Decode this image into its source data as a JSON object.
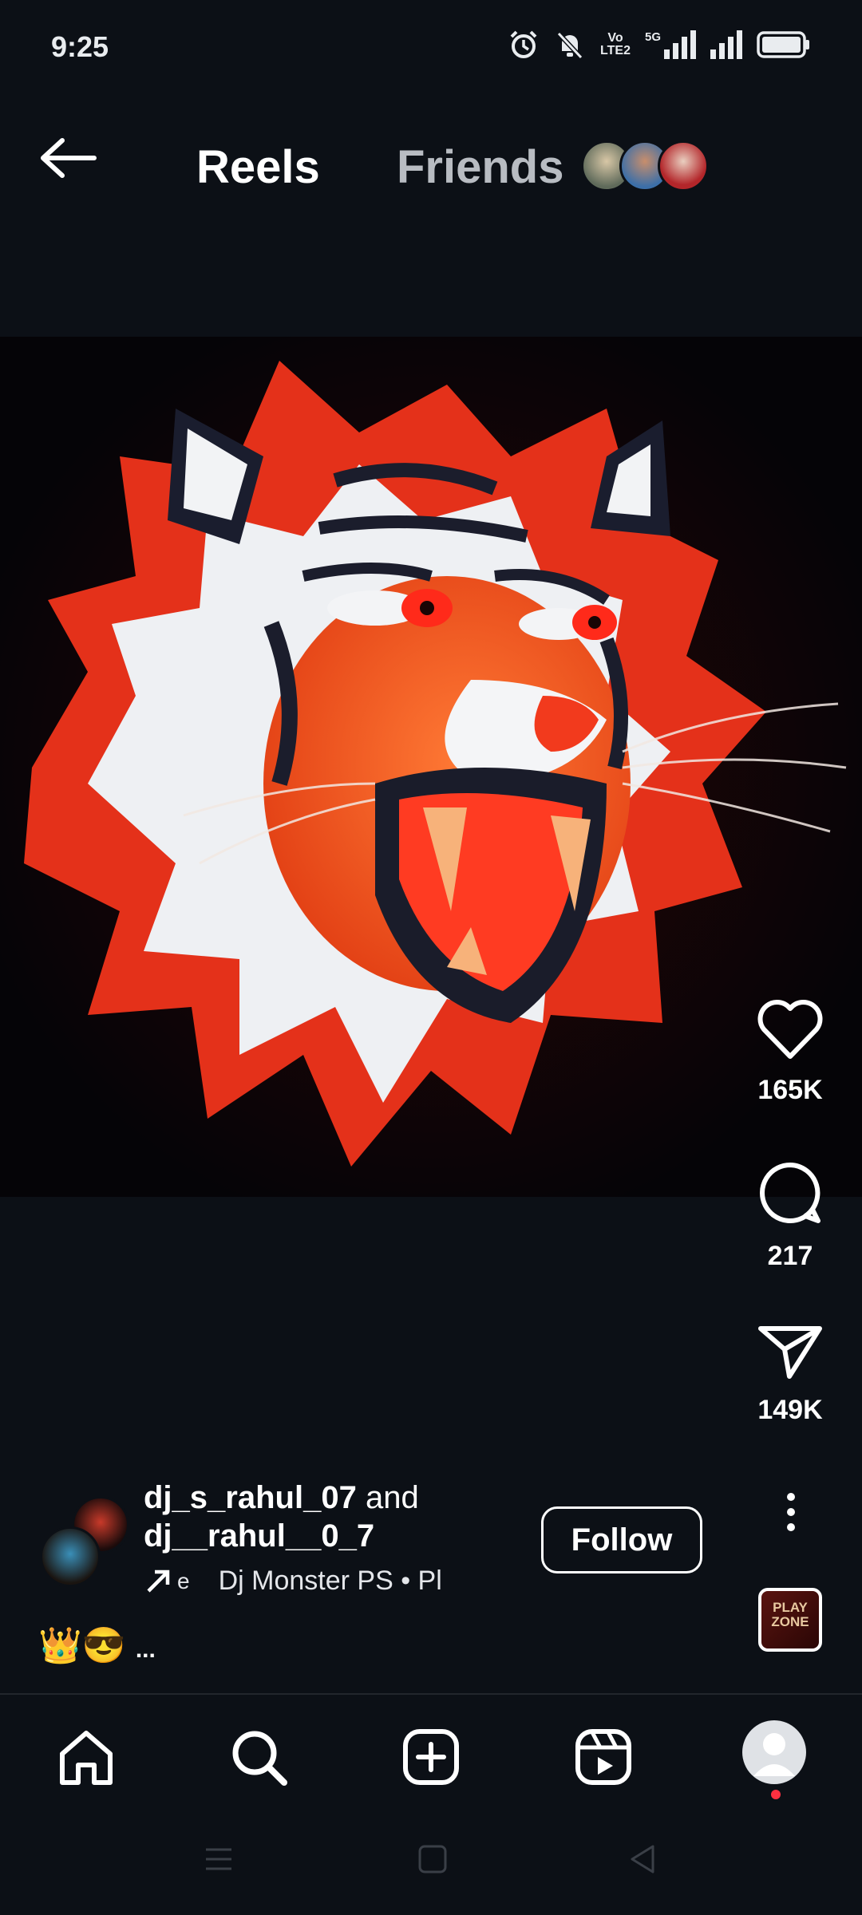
{
  "status_bar": {
    "time": "9:25",
    "network_label_top": "Vo",
    "network_label_bottom": "LTE2",
    "signal_label": "5G"
  },
  "header": {
    "tabs": [
      {
        "label": "Reels",
        "active": true
      },
      {
        "label": "Friends",
        "active": false
      }
    ]
  },
  "actions": {
    "likes": "165K",
    "comments": "217",
    "shares": "149K"
  },
  "author": {
    "user1": "dj_s_rahul_07",
    "connector": "and",
    "user2": "dj__rahul__0_7",
    "audio_prefix": "e",
    "audio": "Dj Monster PS • Pl",
    "follow_label": "Follow"
  },
  "audio_thumb_text": "PLAY ZONE",
  "caption": {
    "emojis": "👑😎",
    "more": "..."
  },
  "colors": {
    "background": "#0c1016",
    "notification_dot": "#ff3040",
    "tiger_orange": "#f0521c"
  },
  "icons": {
    "back": "arrow-left-icon",
    "like": "heart-icon",
    "comment": "comment-bubble-icon",
    "share": "paper-plane-icon",
    "more": "vertical-dots-icon",
    "nav": [
      "home-icon",
      "search-icon",
      "plus-square-icon",
      "reels-icon",
      "profile-avatar"
    ]
  }
}
